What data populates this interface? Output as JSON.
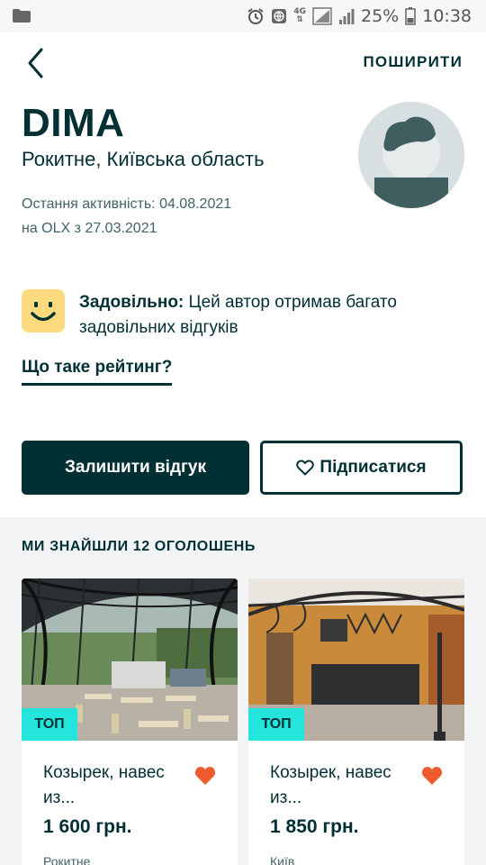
{
  "status_bar": {
    "network": "4G",
    "battery": "25%",
    "time": "10:38"
  },
  "header": {
    "share_label": "ПОШИРИТИ"
  },
  "profile": {
    "name": "DIMA",
    "location": "Рокитне, Київська область",
    "last_activity": "Остання активність: 04.08.2021",
    "since": "на OLX з 27.03.2021"
  },
  "rating": {
    "label": "Задовільно:",
    "description": " Цей автор отримав багато задовільних відгуків",
    "link": "Що таке рейтинг?"
  },
  "actions": {
    "review_label": "Залишити відгук",
    "follow_label": "Підписатися"
  },
  "listings": {
    "heading": "МИ ЗНАЙШЛИ 12 ОГОЛОШЕНЬ",
    "items": [
      {
        "badge": "ТОП",
        "title": "Козырек, навес из...",
        "price": "1 600 грн.",
        "location": "Рокитне"
      },
      {
        "badge": "ТОП",
        "title": "Козырек, навес из...",
        "price": "1 850 грн.",
        "location": "Київ"
      }
    ]
  },
  "colors": {
    "primary": "#002f34",
    "badge": "#23e5db",
    "rating_bg": "#ffd97d",
    "favorite": "#f05a2e",
    "listings_bg": "#f2f4f5"
  }
}
